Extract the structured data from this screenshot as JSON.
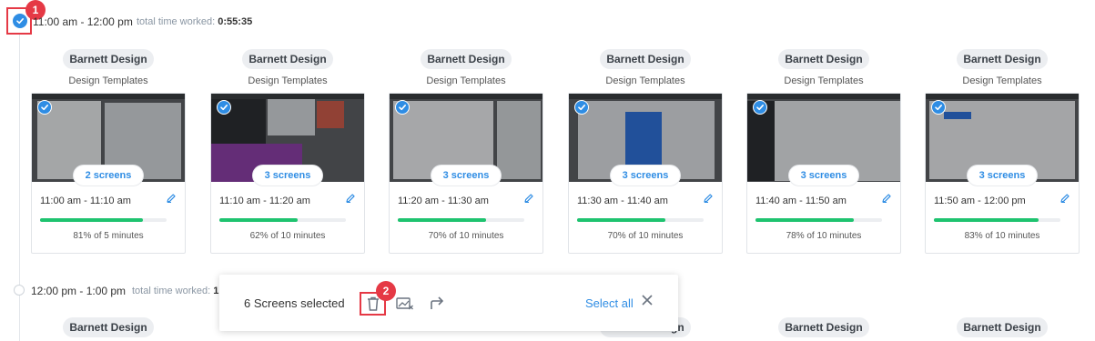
{
  "hours": [
    {
      "range": "11:00 am - 12:00 pm",
      "total_label": "total time worked:",
      "total_value": "0:55:35"
    },
    {
      "range": "12:00 pm - 1:00 pm",
      "total_label": "total time worked:",
      "total_value": "1:"
    }
  ],
  "cards": [
    {
      "project": "Barnett Design",
      "task": "Design Templates",
      "screens": "2 screens",
      "time": "11:00 am - 11:10 am",
      "activity": "81% of 5 minutes",
      "progress": 0.81
    },
    {
      "project": "Barnett Design",
      "task": "Design Templates",
      "screens": "3 screens",
      "time": "11:10 am - 11:20 am",
      "activity": "62% of 10 minutes",
      "progress": 0.62
    },
    {
      "project": "Barnett Design",
      "task": "Design Templates",
      "screens": "3 screens",
      "time": "11:20 am - 11:30 am",
      "activity": "70% of 10 minutes",
      "progress": 0.7
    },
    {
      "project": "Barnett Design",
      "task": "Design Templates",
      "screens": "3 screens",
      "time": "11:30 am - 11:40 am",
      "activity": "70% of 10 minutes",
      "progress": 0.7
    },
    {
      "project": "Barnett Design",
      "task": "Design Templates",
      "screens": "3 screens",
      "time": "11:40 am - 11:50 am",
      "activity": "78% of 10 minutes",
      "progress": 0.78
    },
    {
      "project": "Barnett Design",
      "task": "Design Templates",
      "screens": "3 screens",
      "time": "11:50 am - 12:00 pm",
      "activity": "83% of 10 minutes",
      "progress": 0.83
    }
  ],
  "second_row_projects": [
    "Barnett Design",
    "Barnett Design",
    "Barnett Design",
    "Barnett Design"
  ],
  "toolbar": {
    "selected_text": "6 Screens selected",
    "select_all": "Select all"
  },
  "step_badges": [
    "1",
    "2"
  ],
  "colors": {
    "accent": "#2f8de4",
    "progress": "#1ec36f",
    "highlight": "#e53945"
  },
  "icons": [
    "check-icon",
    "pencil-icon",
    "trash-icon",
    "image-off-icon",
    "share-arrow-icon",
    "close-icon"
  ]
}
